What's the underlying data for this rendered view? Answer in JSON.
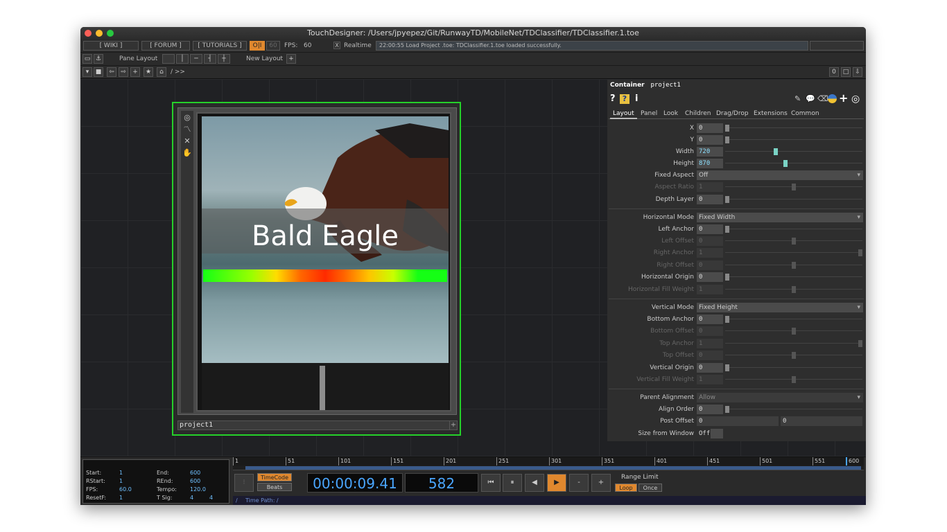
{
  "window": {
    "title": "TouchDesigner: /Users/jpyepez/Git/RunwayTD/MobileNet/TDClassifier/TDClassifier.1.toe"
  },
  "toolbar1": {
    "wiki": "[ WIKI ]",
    "forum": "[ FORUM ]",
    "tutorials": "[ TUTORIALS ]",
    "oi": "O|I",
    "fps_limit": "60",
    "fps_label": "FPS:",
    "fps_value": "60",
    "realtime_check": "X",
    "realtime_label": "Realtime",
    "status": "22:00:55 Load Project .toe: TDClassifier.1.toe loaded successfully."
  },
  "toolbar2": {
    "pane_layout": "Pane Layout",
    "new_layout": "New Layout",
    "plus": "+"
  },
  "toolbar3": {
    "path": "/ >>",
    "count": "0"
  },
  "node": {
    "name": "project1",
    "label_text": "Bald Eagle"
  },
  "params": {
    "op_type": "Container",
    "op_name": "project1",
    "tabs": [
      "Layout",
      "Panel",
      "Look",
      "Children",
      "Drag/Drop",
      "Extensions",
      "Common"
    ],
    "rows": {
      "x": {
        "label": "X",
        "value": "0"
      },
      "y": {
        "label": "Y",
        "value": "0"
      },
      "width": {
        "label": "Width",
        "value": "720"
      },
      "height": {
        "label": "Height",
        "value": "870"
      },
      "fixed_aspect": {
        "label": "Fixed Aspect",
        "value": "Off"
      },
      "aspect_ratio": {
        "label": "Aspect Ratio",
        "value": "1"
      },
      "depth_layer": {
        "label": "Depth Layer",
        "value": "0"
      },
      "horizontal_mode": {
        "label": "Horizontal Mode",
        "value": "Fixed Width"
      },
      "left_anchor": {
        "label": "Left Anchor",
        "value": "0"
      },
      "left_offset": {
        "label": "Left Offset",
        "value": "0"
      },
      "right_anchor": {
        "label": "Right Anchor",
        "value": "1"
      },
      "right_offset": {
        "label": "Right Offset",
        "value": "0"
      },
      "horizontal_origin": {
        "label": "Horizontal Origin",
        "value": "0"
      },
      "horizontal_fill_weight": {
        "label": "Horizontal Fill Weight",
        "value": "1"
      },
      "vertical_mode": {
        "label": "Vertical Mode",
        "value": "Fixed Height"
      },
      "bottom_anchor": {
        "label": "Bottom Anchor",
        "value": "0"
      },
      "bottom_offset": {
        "label": "Bottom Offset",
        "value": "0"
      },
      "top_anchor": {
        "label": "Top Anchor",
        "value": "1"
      },
      "top_offset": {
        "label": "Top Offset",
        "value": "0"
      },
      "vertical_origin": {
        "label": "Vertical Origin",
        "value": "0"
      },
      "vertical_fill_weight": {
        "label": "Vertical Fill Weight",
        "value": "1"
      },
      "parent_alignment": {
        "label": "Parent Alignment",
        "value": "Allow"
      },
      "align_order": {
        "label": "Align Order",
        "value": "0"
      },
      "post_offset": {
        "label": "Post Offset",
        "value1": "0",
        "value2": "0"
      },
      "size_from_window": {
        "label": "Size from Window",
        "value": "Off"
      }
    }
  },
  "timeline": {
    "start_label": "Start:",
    "start": "1",
    "end_label": "End:",
    "end": "600",
    "rstart_label": "RStart:",
    "rstart": "1",
    "rend_label": "REnd:",
    "rend": "600",
    "fps_label": "FPS:",
    "fps": "60.0",
    "tempo_label": "Tempo:",
    "tempo": "120.0",
    "resetf_label": "ResetF:",
    "resetf": "1",
    "tsig_label": "T Sig:",
    "tsig_a": "4",
    "tsig_b": "4",
    "ruler": [
      "1",
      "51",
      "101",
      "151",
      "201",
      "251",
      "301",
      "351",
      "401",
      "451",
      "501",
      "551",
      "600"
    ],
    "timecode_btn": "TimeCode",
    "beats_btn": "Beats",
    "timecode": "00:00:09.41",
    "frame": "582",
    "range_limit": "Range Limit",
    "loop": "Loop",
    "once": "Once",
    "path_label": "Time Path: /",
    "slash": "/",
    "buttons": {
      "first": "⏮",
      "pause": "⏸",
      "back": "◀",
      "play": "▶",
      "minus": "-",
      "plus": "+"
    }
  },
  "colors": {
    "accent_orange": "#e0882e",
    "selected_green": "#25d02a",
    "timecode_blue": "#4aa6ff"
  }
}
